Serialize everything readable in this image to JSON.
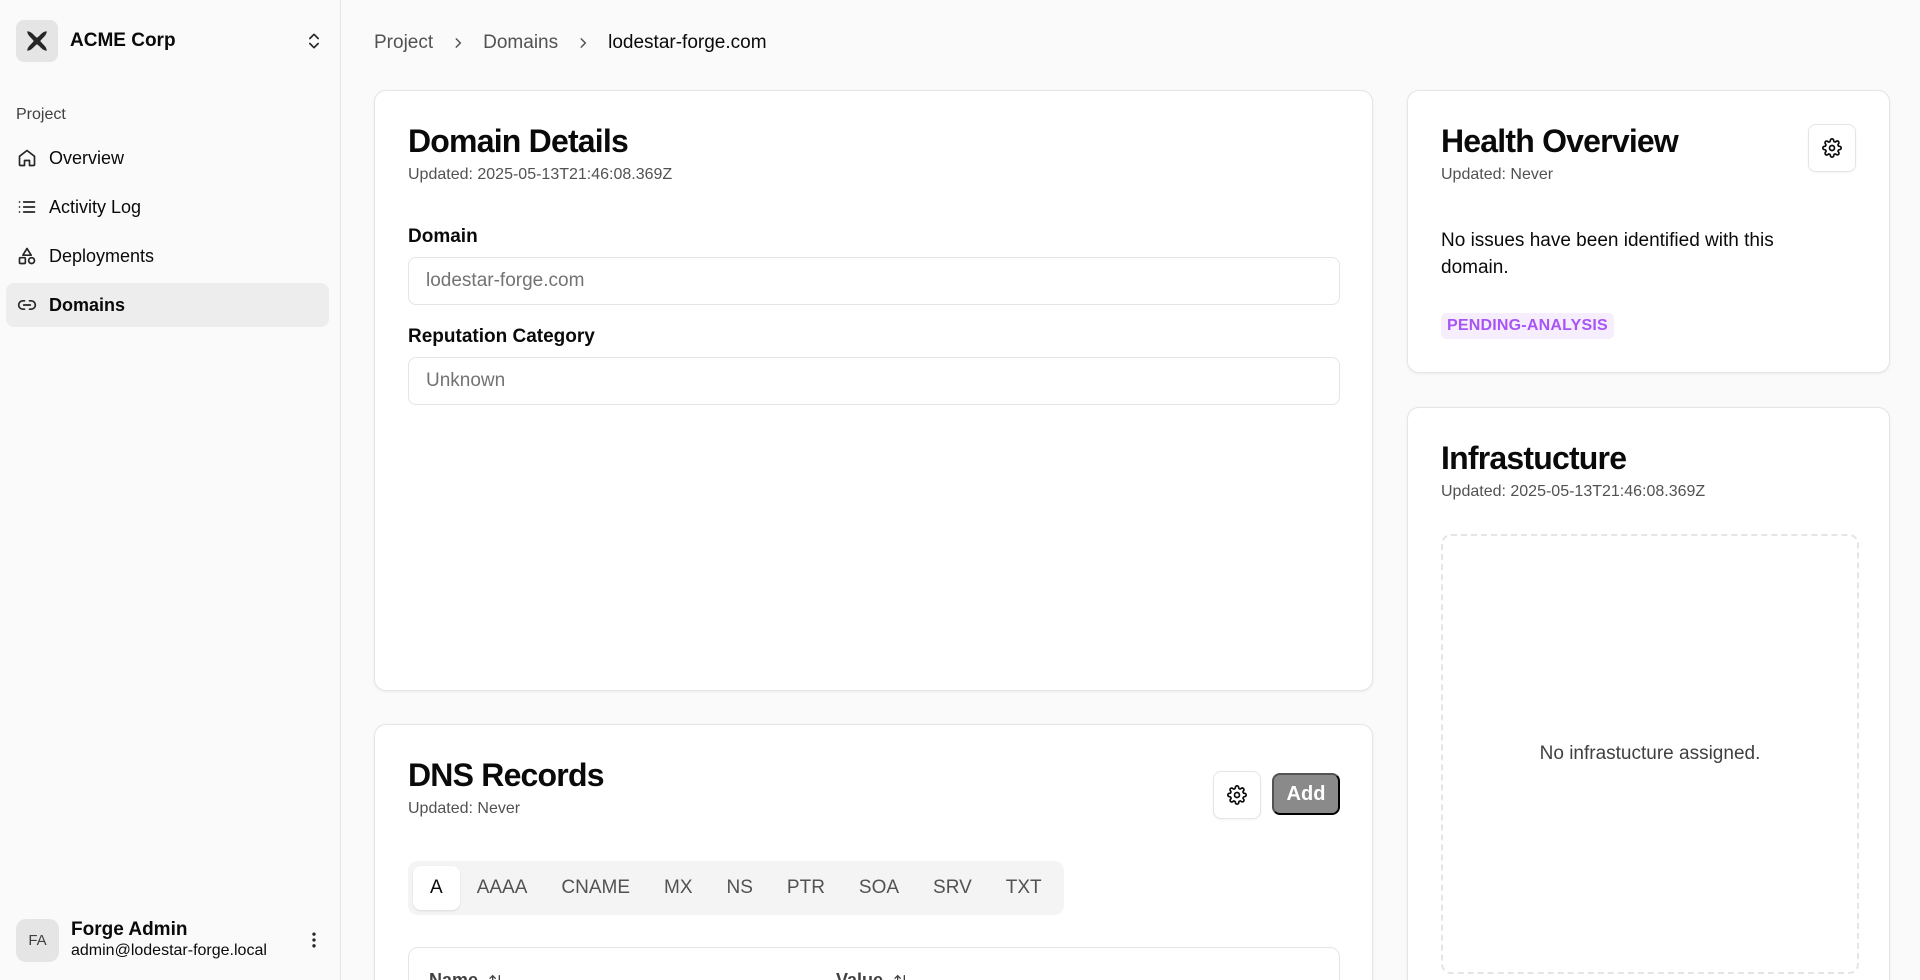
{
  "org": {
    "name": "ACME Corp",
    "logo_icon": "acme-logo-icon"
  },
  "nav": {
    "group_label": "Project",
    "items": [
      {
        "label": "Overview",
        "icon": "home-icon"
      },
      {
        "label": "Activity Log",
        "icon": "list-icon"
      },
      {
        "label": "Deployments",
        "icon": "shapes-icon"
      },
      {
        "label": "Domains",
        "icon": "link-icon",
        "active": true
      }
    ]
  },
  "user": {
    "initials": "FA",
    "name": "Forge Admin",
    "email": "admin@lodestar-forge.local"
  },
  "breadcrumb": {
    "items": [
      "Project",
      "Domains"
    ],
    "current": "lodestar-forge.com"
  },
  "domain_details": {
    "title": "Domain Details",
    "updated": "Updated: 2025-05-13T21:46:08.369Z",
    "domain_label": "Domain",
    "domain_placeholder": "lodestar-forge.com",
    "reputation_label": "Reputation Category",
    "reputation_placeholder": "Unknown"
  },
  "dns_records": {
    "title": "DNS Records",
    "updated": "Updated: Never",
    "add_label": "Add",
    "tabs": [
      "A",
      "AAAA",
      "CNAME",
      "MX",
      "NS",
      "PTR",
      "SOA",
      "SRV",
      "TXT"
    ],
    "active_tab": "A",
    "columns": [
      "Name",
      "Value"
    ]
  },
  "health": {
    "title": "Health Overview",
    "updated": "Updated: Never",
    "message": "No issues have been identified with this domain.",
    "status_badge": "PENDING-ANALYSIS",
    "badge_color": "#a855f7"
  },
  "infrastructure": {
    "title": "Infrastucture",
    "updated": "Updated: 2025-05-13T21:46:08.369Z",
    "empty_message": "No infrastucture assigned."
  }
}
